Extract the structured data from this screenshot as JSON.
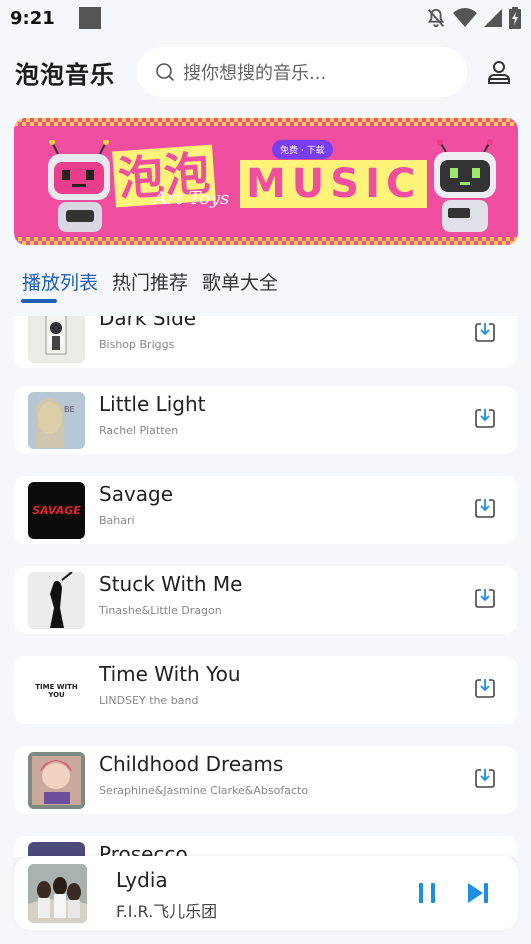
{
  "status": {
    "time": "9:21"
  },
  "header": {
    "app_title": "泡泡音乐",
    "search_placeholder": "搜你想搜的音乐..."
  },
  "banner": {
    "title_cn": "泡泡",
    "title_en": "MUSIC",
    "badge": "免费 · 下载",
    "subtitle": "Art Toys"
  },
  "tabs": [
    {
      "label": "播放列表",
      "active": true
    },
    {
      "label": "热门推荐",
      "active": false
    },
    {
      "label": "歌单大全",
      "active": false
    }
  ],
  "songs": [
    {
      "title": "Dark Side",
      "artist": "Bishop Briggs"
    },
    {
      "title": "Little Light",
      "artist": "Rachel Platten"
    },
    {
      "title": "Savage",
      "artist": "Bahari",
      "cover_text": "SAVAGE"
    },
    {
      "title": "Stuck With Me",
      "artist": "Tinashe&Little Dragon"
    },
    {
      "title": "Time With You",
      "artist": "LINDSEY the band",
      "cover_text": "TIME WITH YOU"
    },
    {
      "title": "Childhood Dreams",
      "artist": "Seraphine&Jasmine Clarke&Absofacto"
    },
    {
      "title": "Prosecco",
      "artist": ""
    }
  ],
  "player": {
    "title": "Lydia",
    "artist": "F.I.R.飞儿乐团"
  },
  "colors": {
    "accent": "#1f5fb4",
    "banner_pink": "#ef4f9e",
    "banner_yellow": "#fff37a",
    "player_icon": "#1e8fe0"
  }
}
